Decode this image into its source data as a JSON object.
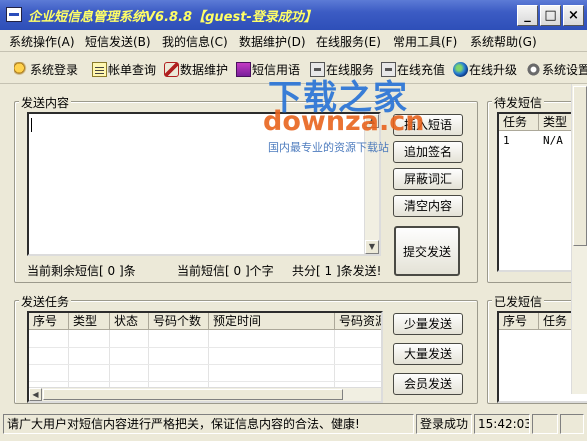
{
  "window": {
    "title": "企业短信息管理系统V6.8.8【guest-登录成功】",
    "min_glyph": "_",
    "max_glyph": "□",
    "close_glyph": "×"
  },
  "menu": [
    "系统操作(A)",
    "短信发送(B)",
    "我的信息(C)",
    "数据维护(D)",
    "在线服务(E)",
    "常用工具(F)",
    "系统帮助(G)"
  ],
  "toolbar": [
    "系统登录",
    "帐单查询",
    "数据维护",
    "短信用语",
    "在线服务",
    "在线充值",
    "在线升级",
    "系统设置"
  ],
  "send_content": {
    "legend": "发送内容",
    "remaining": "当前剩余短信[ 0 ]条",
    "current_chars": "当前短信[ 0 ]个字",
    "total": "共分[ 1 ]条发送!",
    "buttons": {
      "insert": "插入短语",
      "signature": "追加签名",
      "filter": "屏蔽词汇",
      "clear": "清空内容",
      "submit": "提交发送"
    }
  },
  "pending": {
    "legend": "待发短信",
    "columns": [
      "任务",
      "类型"
    ],
    "rows": [
      [
        "1",
        "N/A"
      ]
    ]
  },
  "tasks": {
    "legend": "发送任务",
    "columns": [
      "序号",
      "类型",
      "状态",
      "号码个数",
      "预定时间",
      "号码资源"
    ],
    "buttons": {
      "small": "少量发送",
      "large": "大量发送",
      "member": "会员发送"
    }
  },
  "sent": {
    "legend": "已发短信",
    "columns": [
      "序号",
      "任务"
    ]
  },
  "status": {
    "notice": "请广大用户对短信内容进行严格把关，保证信息内容的合法、健康!",
    "login": "登录成功",
    "time": "15:42:03"
  },
  "watermark": {
    "cn": "下载之家",
    "en": "downza.cn",
    "slogan": "国内最专业的资源下载站"
  }
}
